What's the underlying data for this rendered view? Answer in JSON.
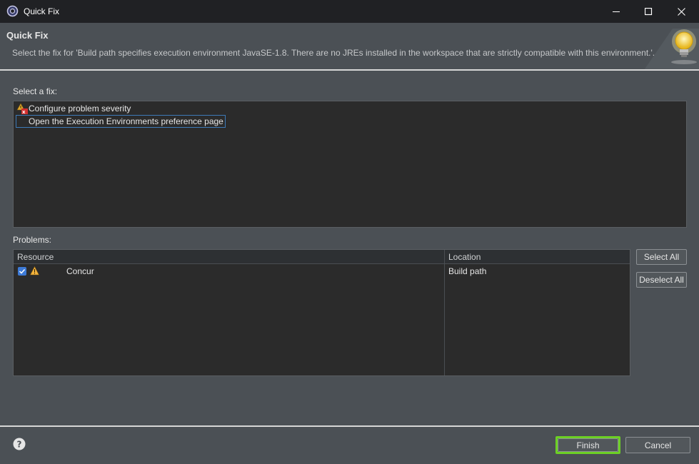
{
  "window": {
    "title": "Quick Fix",
    "icon": "eclipse-gear-icon"
  },
  "banner": {
    "title": "Quick Fix",
    "description": "Select the fix for 'Build path specifies execution environment JavaSE-1.8. There are no JREs installed in the workspace that are strictly compatible with this environment.'."
  },
  "fixes": {
    "label": "Select a fix:",
    "items": [
      {
        "label": "Configure problem severity",
        "icon": "severity-icon"
      },
      {
        "label": "Open the Execution Environments preference page",
        "selected": true
      }
    ]
  },
  "problems": {
    "label": "Problems:",
    "columns": [
      "Resource",
      "Location"
    ],
    "rows": [
      {
        "checked": true,
        "resource": "Concur",
        "location": "Build path",
        "icon": "warning-icon"
      }
    ]
  },
  "buttons": {
    "select_all": "Select All",
    "deselect_all": "Deselect All",
    "finish": "Finish",
    "cancel": "Cancel"
  },
  "colors": {
    "accent": "#3d7ad6",
    "focus_outline": "#6cd024"
  }
}
